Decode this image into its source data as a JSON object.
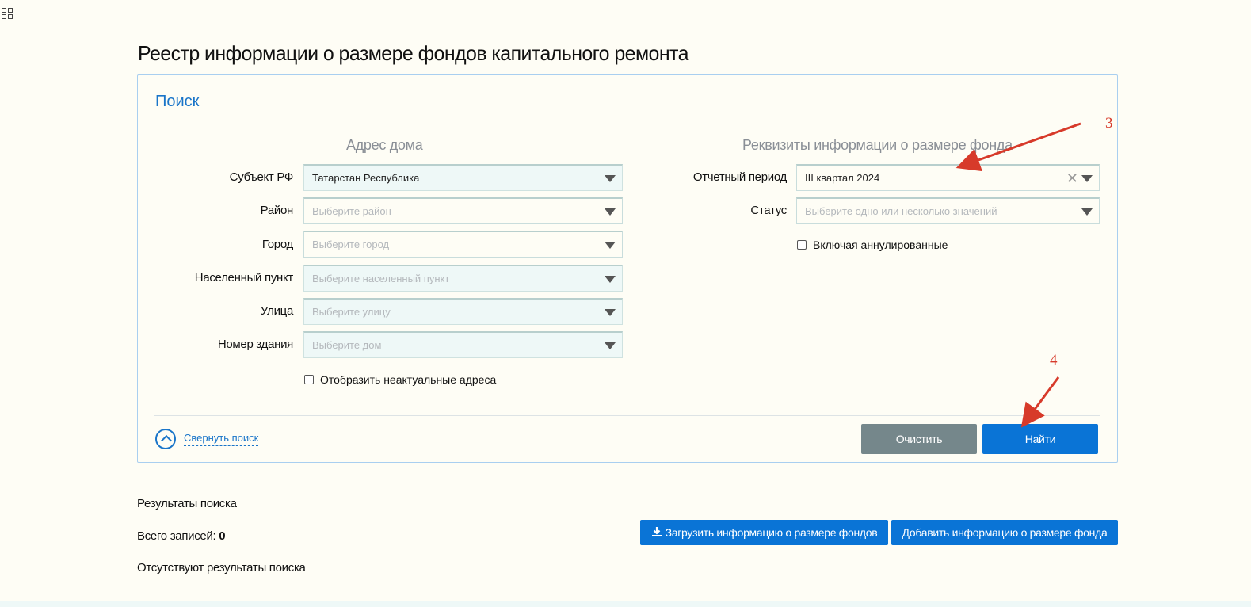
{
  "page": {
    "title": "Реестр информации о размере фондов капитального ремонта"
  },
  "search": {
    "title": "Поиск",
    "address_group_title": "Адрес дома",
    "details_group_title": "Реквизиты информации о размере фонда",
    "fields": {
      "subject": {
        "label": "Субъект РФ",
        "value": "Татарстан Республика"
      },
      "district": {
        "label": "Район",
        "placeholder": "Выберите район"
      },
      "city": {
        "label": "Город",
        "placeholder": "Выберите город"
      },
      "settlement": {
        "label": "Населенный пункт",
        "placeholder": "Выберите населенный пункт"
      },
      "street": {
        "label": "Улица",
        "placeholder": "Выберите улицу"
      },
      "building": {
        "label": "Номер здания",
        "placeholder": "Выберите дом"
      },
      "period": {
        "label": "Отчетный период",
        "value": "III квартал 2024"
      },
      "status": {
        "label": "Статус",
        "placeholder": "Выберите одно или несколько значений"
      }
    },
    "show_obsolete_label": "Отобразить неактуальные адреса",
    "include_annulled_label": "Включая аннулированные",
    "collapse_label": "Свернуть поиск",
    "clear_button": "Очистить",
    "find_button": "Найти"
  },
  "results": {
    "heading": "Результаты поиска",
    "total_label": "Всего записей:",
    "total_value": "0",
    "empty_message": "Отсутствуют результаты поиска",
    "upload_button": "Загрузить информацию о размере фондов",
    "add_button": "Добавить информацию о размере фонда"
  },
  "annotations": {
    "step3": "3",
    "step4": "4"
  },
  "colors": {
    "accent": "#0a74d6",
    "link": "#1a75c9",
    "clear_button": "#75878b",
    "annotation": "#d73a2a"
  }
}
